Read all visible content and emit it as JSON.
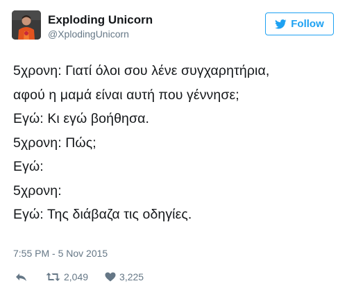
{
  "user": {
    "name": "Exploding Unicorn",
    "handle": "@XplodingUnicorn"
  },
  "follow": {
    "label": "Follow"
  },
  "tweet": {
    "lines": [
      "5χρονη: Γιατί όλοι σου λένε συγχαρητήρια,",
      "αφού η μαμά είναι αυτή που γέννησε;",
      "Εγώ: Κι εγώ βοήθησα.",
      "5χρονη: Πώς;",
      "Εγώ:",
      "5χρονη:",
      "Εγώ: Της διάβαζα τις οδηγίες."
    ]
  },
  "meta": {
    "timestamp": "7:55 PM - 5 Nov 2015"
  },
  "actions": {
    "retweet_count": "2,049",
    "like_count": "3,225"
  },
  "colors": {
    "accent": "#1da1f2",
    "muted": "#657786",
    "text": "#14171a"
  },
  "icons": {
    "follow": "bird-icon",
    "reply": "reply-icon",
    "retweet": "retweet-icon",
    "like": "heart-icon"
  }
}
